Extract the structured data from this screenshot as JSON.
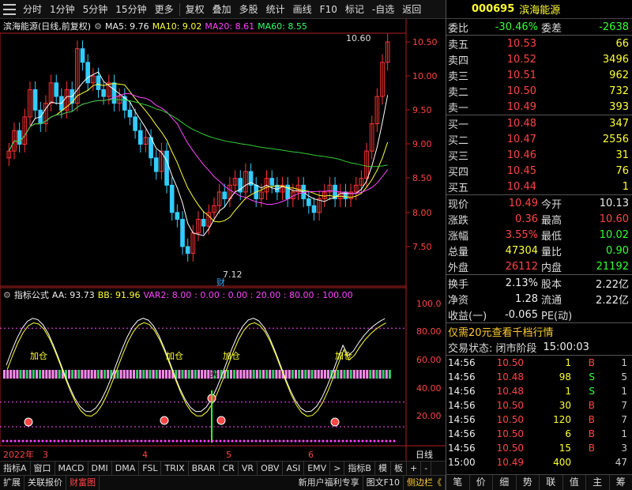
{
  "toolbar": {
    "items": [
      "分时",
      "1分钟",
      "5分钟",
      "15分钟",
      "更多",
      "复权",
      "叠加",
      "多股",
      "统计",
      "画线",
      "F10",
      "标记",
      "-自选",
      "返回"
    ]
  },
  "chart_title": {
    "name": "滨海能源(日线,前复权)",
    "ma5": "MA5: 9.76",
    "ma10": "MA10: 9.02",
    "ma20": "MA20: 8.61",
    "ma60": "MA60: 8.55"
  },
  "price_axis": [
    "10.50",
    "10.00",
    "9.50",
    "9.00",
    "8.50",
    "8.00",
    "7.50"
  ],
  "annotations": {
    "high": "10.60",
    "low": "7.12",
    "cai": "财"
  },
  "indicator": {
    "name": "指标公式",
    "aa": "AA: 93.73",
    "bb": "BB: 91.96",
    "var2": "VAR2: 8.00",
    "levels": ": 0.00  : 0.00  : 20.00  : 80.00  : 100.00",
    "axis": [
      "100.0",
      "80.00",
      "60.00",
      "40.00",
      "20.00"
    ],
    "add_label": "加仓",
    "buy_label": "买"
  },
  "date_axis": {
    "year": "2022年",
    "m3": "3",
    "m4": "4",
    "m5": "5",
    "m6": "6",
    "period": "日线"
  },
  "tabs_row1": [
    "指标A",
    "窗口",
    "MACD",
    "DMI",
    "DMA",
    "FSL",
    "TRIX",
    "BRAR",
    "CR",
    "VR",
    "OBV",
    "ASI",
    "EMV",
    ">",
    "指标B",
    "模",
    "板",
    "+",
    "-"
  ],
  "tabs_row2": [
    "扩展",
    "关联报价",
    "财富图"
  ],
  "tabs_row2_right": [
    "新用户福利专享",
    "图文F10",
    "侧边栏《"
  ],
  "stock": {
    "code": "000695",
    "name": "滨海能源"
  },
  "weibi": {
    "label1": "委比",
    "value1": "-30.46%",
    "label2": "委差",
    "value2": "-2638"
  },
  "asks": [
    {
      "label": "卖五",
      "price": "10.53",
      "vol": "66"
    },
    {
      "label": "卖四",
      "price": "10.52",
      "vol": "3496"
    },
    {
      "label": "卖三",
      "price": "10.51",
      "vol": "962"
    },
    {
      "label": "卖二",
      "price": "10.50",
      "vol": "732"
    },
    {
      "label": "卖一",
      "price": "10.49",
      "vol": "393"
    }
  ],
  "bids": [
    {
      "label": "买一",
      "price": "10.48",
      "vol": "347"
    },
    {
      "label": "买二",
      "price": "10.47",
      "vol": "2556"
    },
    {
      "label": "买三",
      "price": "10.46",
      "vol": "31"
    },
    {
      "label": "买四",
      "price": "10.45",
      "vol": "76"
    },
    {
      "label": "买五",
      "price": "10.44",
      "vol": "1"
    }
  ],
  "quote": [
    {
      "l1": "现价",
      "v1": "10.49",
      "c1": "#ff4444",
      "l2": "今开",
      "v2": "10.13",
      "c2": "#eeeeee"
    },
    {
      "l1": "涨跌",
      "v1": "0.36",
      "c1": "#ff4444",
      "l2": "最高",
      "v2": "10.60",
      "c2": "#ff4444"
    },
    {
      "l1": "涨幅",
      "v1": "3.55%",
      "c1": "#ff4444",
      "l2": "最低",
      "v2": "10.02",
      "c2": "#33ff33"
    },
    {
      "l1": "总量",
      "v1": "47304",
      "c1": "#ffff33",
      "l2": "量比",
      "v2": "0.90",
      "c2": "#33ff33"
    },
    {
      "l1": "外盘",
      "v1": "26112",
      "c1": "#ff4444",
      "l2": "内盘",
      "v2": "21192",
      "c2": "#33ff33"
    }
  ],
  "quote2": [
    {
      "l1": "换手",
      "v1": "2.13%",
      "l2": "股本",
      "v2": "2.22亿"
    },
    {
      "l1": "净资",
      "v1": "1.28",
      "l2": "流通",
      "v2": "2.22亿"
    },
    {
      "l1": "收益(一)",
      "v1": "-0.065",
      "l2": "PE(动)",
      "v2": ""
    }
  ],
  "promo": "仅需20元查看千档行情",
  "status": {
    "label": "交易状态: 闭市阶段",
    "time": "15:00:03"
  },
  "ticks": [
    {
      "t": "14:56",
      "p": "10.50",
      "v": "1",
      "d": "B",
      "dc": "#ff4444",
      "n": "1"
    },
    {
      "t": "14:56",
      "p": "10.48",
      "v": "98",
      "d": "S",
      "dc": "#33ff33",
      "n": "5"
    },
    {
      "t": "14:56",
      "p": "10.48",
      "v": "1",
      "d": "S",
      "dc": "#33ff33",
      "n": "1"
    },
    {
      "t": "14:56",
      "p": "10.50",
      "v": "30",
      "d": "B",
      "dc": "#ff4444",
      "n": "7"
    },
    {
      "t": "14:56",
      "p": "10.50",
      "v": "120",
      "d": "B",
      "dc": "#ff4444",
      "n": "7"
    },
    {
      "t": "14:56",
      "p": "10.50",
      "v": "6",
      "d": "B",
      "dc": "#ff4444",
      "n": "1"
    },
    {
      "t": "14:56",
      "p": "10.50",
      "v": "15",
      "d": "B",
      "dc": "#ff4444",
      "n": "3"
    },
    {
      "t": "15:00",
      "p": "10.49",
      "v": "400",
      "d": "",
      "dc": "#ff4444",
      "n": "47"
    }
  ],
  "bottom_buttons": [
    "笔",
    "价",
    "细",
    "势",
    "联",
    "值",
    "主",
    "筹"
  ]
}
